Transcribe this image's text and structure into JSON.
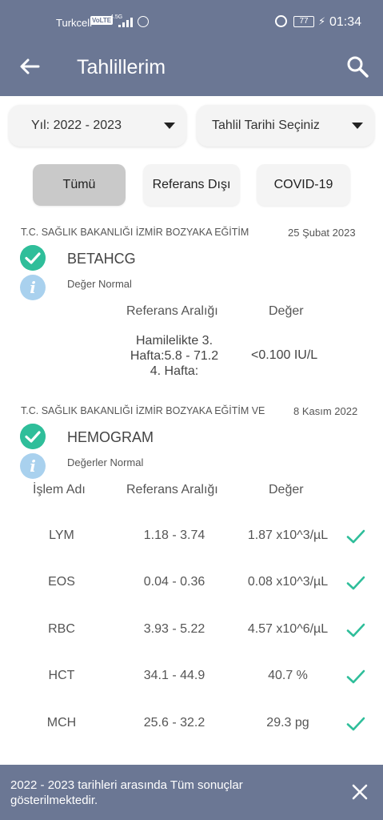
{
  "status_bar": {
    "carrier": "Turkcell",
    "volte": "VoLTE",
    "network": "4.5G",
    "battery": "77",
    "time": "01:34"
  },
  "app_bar": {
    "title": "Tahlillerim",
    "back_icon": "arrow-left-icon",
    "search_icon": "search-icon"
  },
  "filters": {
    "year_label": "Yıl: 2022 - 2023",
    "date_label": "Tahlil Tarihi Seçiniz"
  },
  "tabs": [
    {
      "label": "Tümü",
      "selected": true
    },
    {
      "label": "Referans Dışı",
      "selected": false
    },
    {
      "label": "COVID-19",
      "selected": false
    }
  ],
  "results": [
    {
      "hospital": "T.C. SAĞLIK BAKANLIĞI İZMİR BOZYAKA EĞİTİM",
      "date": "25 Şubat 2023",
      "test_name": "BETAHCG",
      "status": "Değer Normal",
      "col_ref": "Referans Aralığı",
      "col_value": "Değer",
      "reference_lines": [
        "Hamilelikte 3.",
        "Hafta:5.8 - 71.2",
        "4. Hafta:"
      ],
      "value": "<0.100 IU/L"
    },
    {
      "hospital": "T.C. SAĞLIK BAKANLIĞI İZMİR BOZYAKA EĞİTİM VE",
      "date": "8 Kasım 2022",
      "test_name": "HEMOGRAM",
      "status": "Değerler Normal",
      "col_name": "İşlem Adı",
      "col_ref": "Referans Aralığı",
      "col_value": "Değer",
      "rows": [
        {
          "name": "LYM",
          "ref": "1.18 - 3.74",
          "value": "1.87 x10^3/µL"
        },
        {
          "name": "EOS",
          "ref": "0.04 - 0.36",
          "value": "0.08 x10^3/µL"
        },
        {
          "name": "RBC",
          "ref": "3.93 - 5.22",
          "value": "4.57 x10^6/µL"
        },
        {
          "name": "HCT",
          "ref": "34.1 - 44.9",
          "value": "40.7 %"
        },
        {
          "name": "MCH",
          "ref": "25.6 - 32.2",
          "value": "29.3 pg"
        }
      ]
    }
  ],
  "snackbar": {
    "message": "2022 - 2023 tarihleri arasında Tüm sonuçlar gösterilmektedir.",
    "close_icon": "close-icon"
  },
  "colors": {
    "primary": "#6b7794",
    "success": "#2fbe9a",
    "info": "#a9d1ee"
  }
}
